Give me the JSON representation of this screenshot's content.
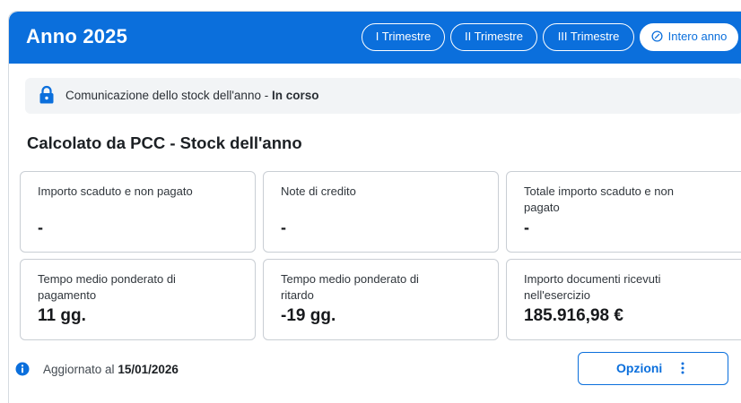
{
  "header": {
    "title": "Anno 2025",
    "periods": [
      {
        "label": "I Trimestre"
      },
      {
        "label": "II Trimestre"
      },
      {
        "label": "III Trimestre"
      },
      {
        "label": "Intero anno",
        "active": true
      }
    ]
  },
  "banner": {
    "text": "Comunicazione dello stock dell'anno",
    "separator": " - ",
    "status": "In corso",
    "icon": "lock-icon"
  },
  "section": {
    "title": "Calcolato da PCC - Stock dell'anno"
  },
  "tiles": [
    {
      "label_lines": [
        "Importo scaduto e non pagato"
      ],
      "value": "-"
    },
    {
      "label_lines": [
        "Note di credito"
      ],
      "value": "-"
    },
    {
      "label_lines": [
        "Totale importo scaduto e non",
        "pagato"
      ],
      "value": "-"
    },
    {
      "label_lines": [
        "Tempo medio ponderato di",
        "pagamento"
      ],
      "value": "11 gg."
    },
    {
      "label_lines": [
        "Tempo medio ponderato di",
        "ritardo"
      ],
      "value": "-19 gg."
    },
    {
      "label_lines": [
        "Importo documenti ricevuti",
        "nell'esercizio"
      ],
      "value": "185.916,98 €"
    }
  ],
  "footer": {
    "prefix": "Aggiornato al",
    "date": "15/01/2026",
    "icon": "info-icon",
    "options_label": "Opzioni"
  },
  "colors": {
    "primary": "#0b6fdc",
    "banner_bg": "#f2f4f6",
    "tile_border": "#c9ced4"
  }
}
